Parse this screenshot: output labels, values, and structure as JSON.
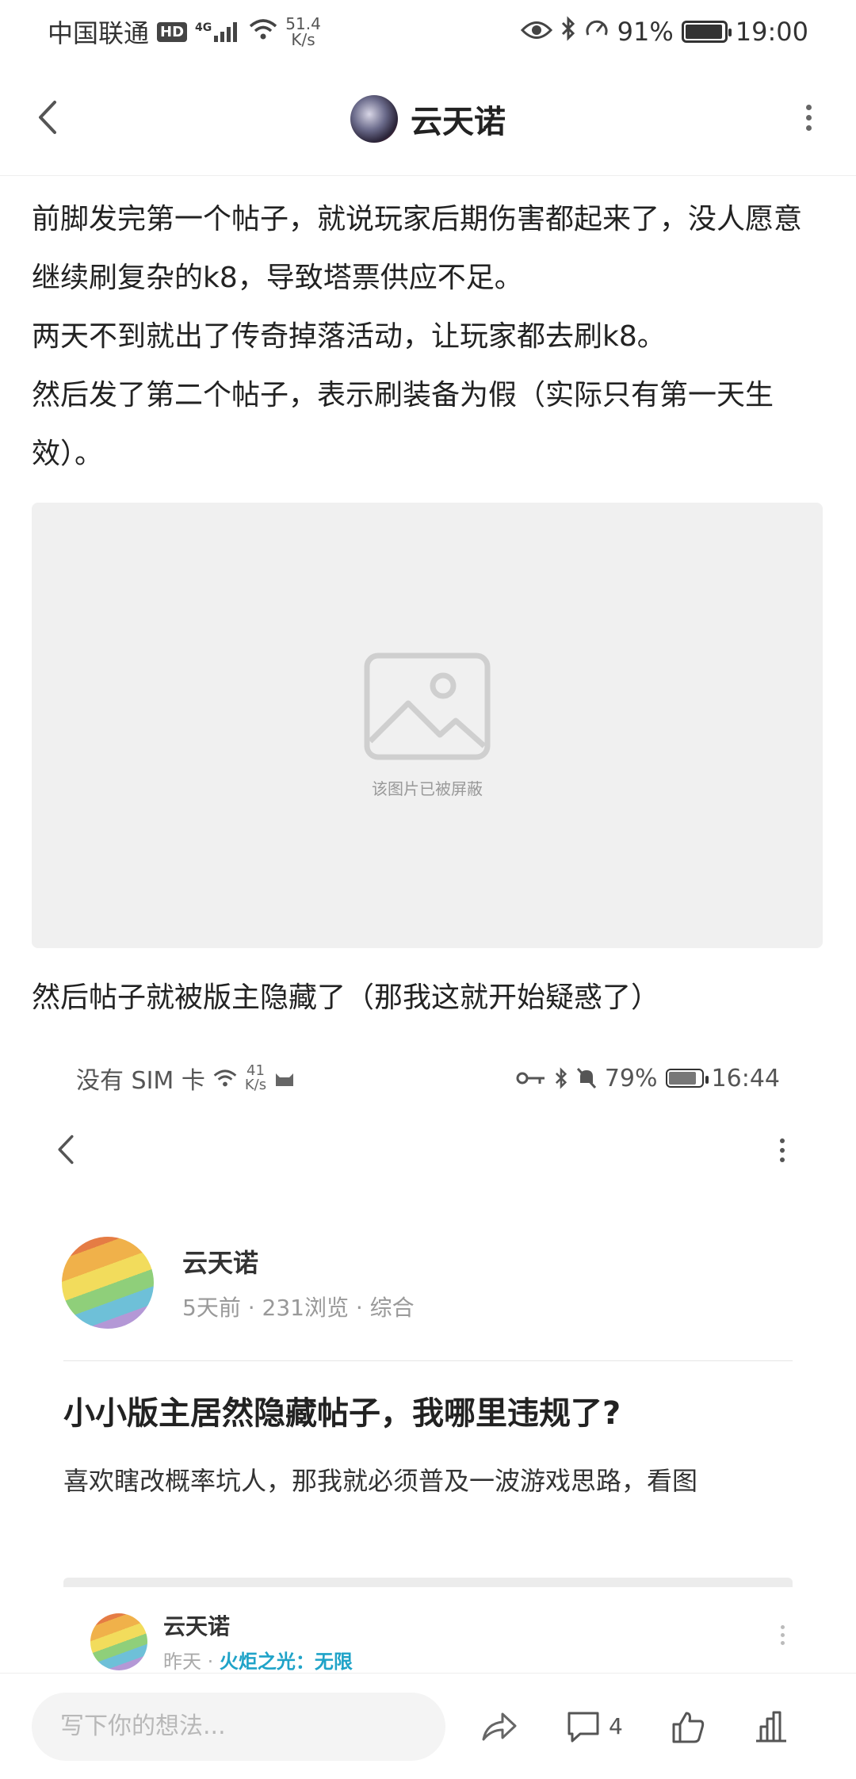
{
  "status_bar": {
    "carrier": "中国联通",
    "hd": "HD",
    "network": "4G",
    "speed_value": "51.4",
    "speed_unit": "K/s",
    "battery": "91%",
    "time": "19:00"
  },
  "header": {
    "title": "云天诺"
  },
  "post": {
    "paragraphs": [
      "前脚发完第一个帖子，就说玩家后期伤害都起来了，没人愿意继续刷复杂的k8，导致塔票供应不足。",
      "两天不到就出了传奇掉落活动，让玩家都去刷k8。",
      "然后发了第二个帖子，表示刷装备为假（实际只有第一天生效）。"
    ],
    "blocked_image_text": "该图片已被屏蔽",
    "after_text": "然后帖子就被版主隐藏了（那我这就开始疑惑了）"
  },
  "embedded": {
    "status": {
      "sim": "没有 SIM 卡",
      "speed_value": "41",
      "speed_unit": "K/s",
      "battery": "79%",
      "time": "16:44"
    },
    "username": "云天诺",
    "meta": "5天前 · 231浏览 · 综合",
    "title": "小小版主居然隐藏帖子，我哪里违规了?",
    "desc": "喜欢瞎改概率坑人，那我就必须普及一波游戏思路，看图",
    "comment": {
      "username": "云天诺",
      "time": "昨天",
      "sep": "·",
      "tag": "火炬之光：无限"
    }
  },
  "bottom_bar": {
    "input_placeholder": "写下你的想法...",
    "comment_count": "4"
  },
  "colors": {
    "accent_teal": "#1fa3c8",
    "text": "#222222",
    "placeholder_bg": "#f0f0f0"
  }
}
